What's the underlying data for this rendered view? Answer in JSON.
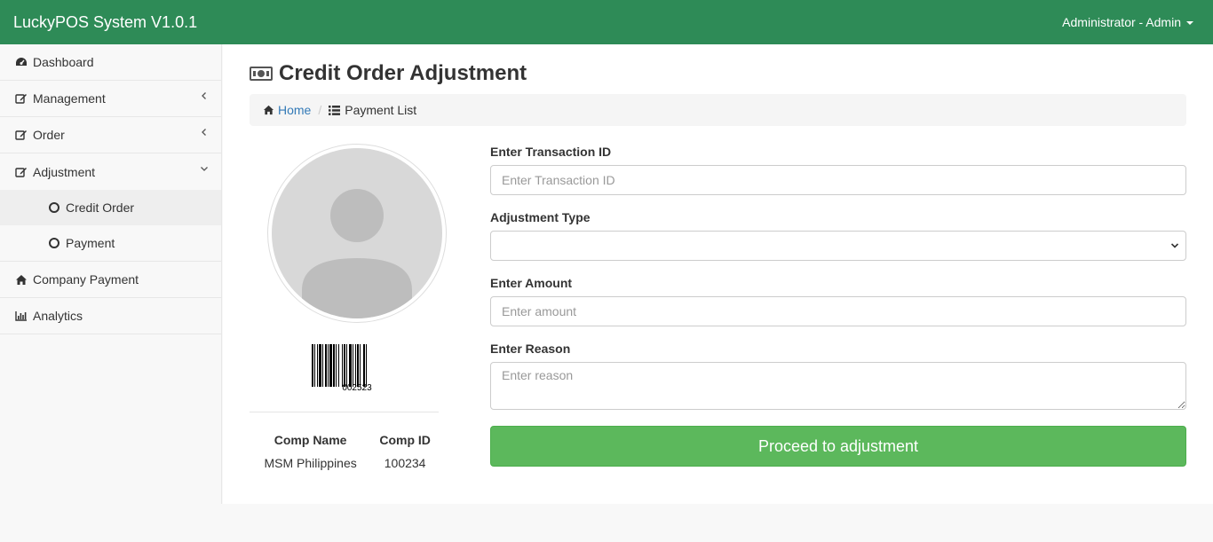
{
  "app": {
    "title": "LuckyPOS System V1.0.1",
    "user": "Administrator - Admin"
  },
  "sidebar": {
    "items": [
      {
        "label": "Dashboard",
        "icon": "dashboard-icon"
      },
      {
        "label": "Management",
        "icon": "edit-icon"
      },
      {
        "label": "Order",
        "icon": "edit-icon"
      },
      {
        "label": "Adjustment",
        "icon": "edit-icon"
      },
      {
        "label": "Company Payment",
        "icon": "home-icon"
      },
      {
        "label": "Analytics",
        "icon": "bar-chart-icon"
      }
    ],
    "sub_items": [
      {
        "label": "Credit Order",
        "active": true
      },
      {
        "label": "Payment",
        "active": false
      }
    ]
  },
  "page": {
    "title": "Credit Order Adjustment",
    "breadcrumb": {
      "home": "Home",
      "current": "Payment List"
    }
  },
  "profile": {
    "barcode_number": "002523",
    "comp_name_header": "Comp Name",
    "comp_id_header": "Comp ID",
    "comp_name": "MSM Philippines",
    "comp_id": "100234"
  },
  "form": {
    "transaction_label": "Enter Transaction ID",
    "transaction_placeholder": "Enter Transaction ID",
    "adjustment_type_label": "Adjustment Type",
    "adjustment_type_value": "",
    "amount_label": "Enter Amount",
    "amount_placeholder": "Enter amount",
    "reason_label": "Enter Reason",
    "reason_placeholder": "Enter reason",
    "submit_label": "Proceed to adjustment"
  },
  "colors": {
    "navbar": "#2e8b57",
    "button": "#5cb85c",
    "link": "#337ab7"
  }
}
